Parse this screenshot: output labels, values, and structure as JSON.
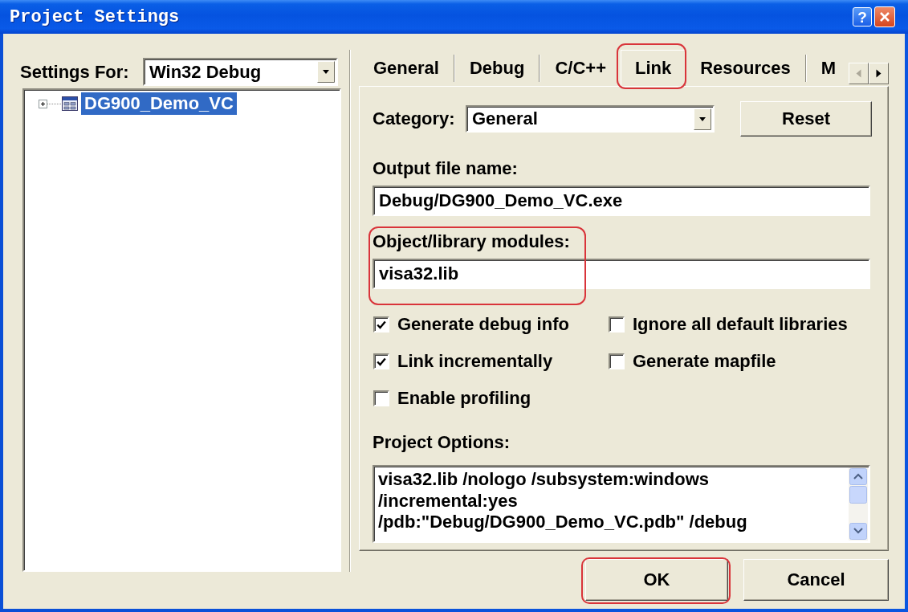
{
  "window": {
    "title": "Project Settings",
    "title_buttons": [
      {
        "kind": "help",
        "label": "?"
      },
      {
        "kind": "close"
      }
    ]
  },
  "settings_for": {
    "label": "Settings For:",
    "value": "Win32 Debug"
  },
  "tree": [
    {
      "label": "DG900_Demo_VC",
      "expanded": false,
      "selected": true
    }
  ],
  "tabs": [
    {
      "label": "General",
      "selected": false,
      "highlighted": false
    },
    {
      "label": "Debug",
      "selected": false,
      "highlighted": false
    },
    {
      "label": "C/C++",
      "selected": false,
      "highlighted": false
    },
    {
      "label": "Link",
      "selected": true,
      "highlighted": true
    },
    {
      "label": "Resources",
      "selected": false,
      "highlighted": false
    },
    {
      "label": "M",
      "selected": false,
      "highlighted": false
    }
  ],
  "tab_page": {
    "category": {
      "label": "Category:",
      "value": "General"
    },
    "reset_button": "Reset",
    "fields": [
      {
        "label": "Output file name:",
        "value": "Debug/DG900_Demo_VC.exe",
        "highlighted": false
      },
      {
        "label": "Object/library modules:",
        "value": "visa32.lib",
        "highlighted": true
      }
    ],
    "checkboxes": [
      {
        "label": "Generate debug info",
        "checked": true
      },
      {
        "label": "Ignore all default libraries",
        "checked": false
      },
      {
        "label": "Link incrementally",
        "checked": true
      },
      {
        "label": "Generate mapfile",
        "checked": false
      },
      {
        "label": "Enable profiling",
        "checked": false
      }
    ],
    "project_options": {
      "label": "Project Options:",
      "lines": [
        "visa32.lib /nologo /subsystem:windows",
        "/incremental:yes",
        "/pdb:\"Debug/DG900_Demo_VC.pdb\" /debug"
      ]
    }
  },
  "buttons": [
    {
      "label": "OK",
      "highlighted": true
    },
    {
      "label": "Cancel",
      "highlighted": false
    }
  ]
}
